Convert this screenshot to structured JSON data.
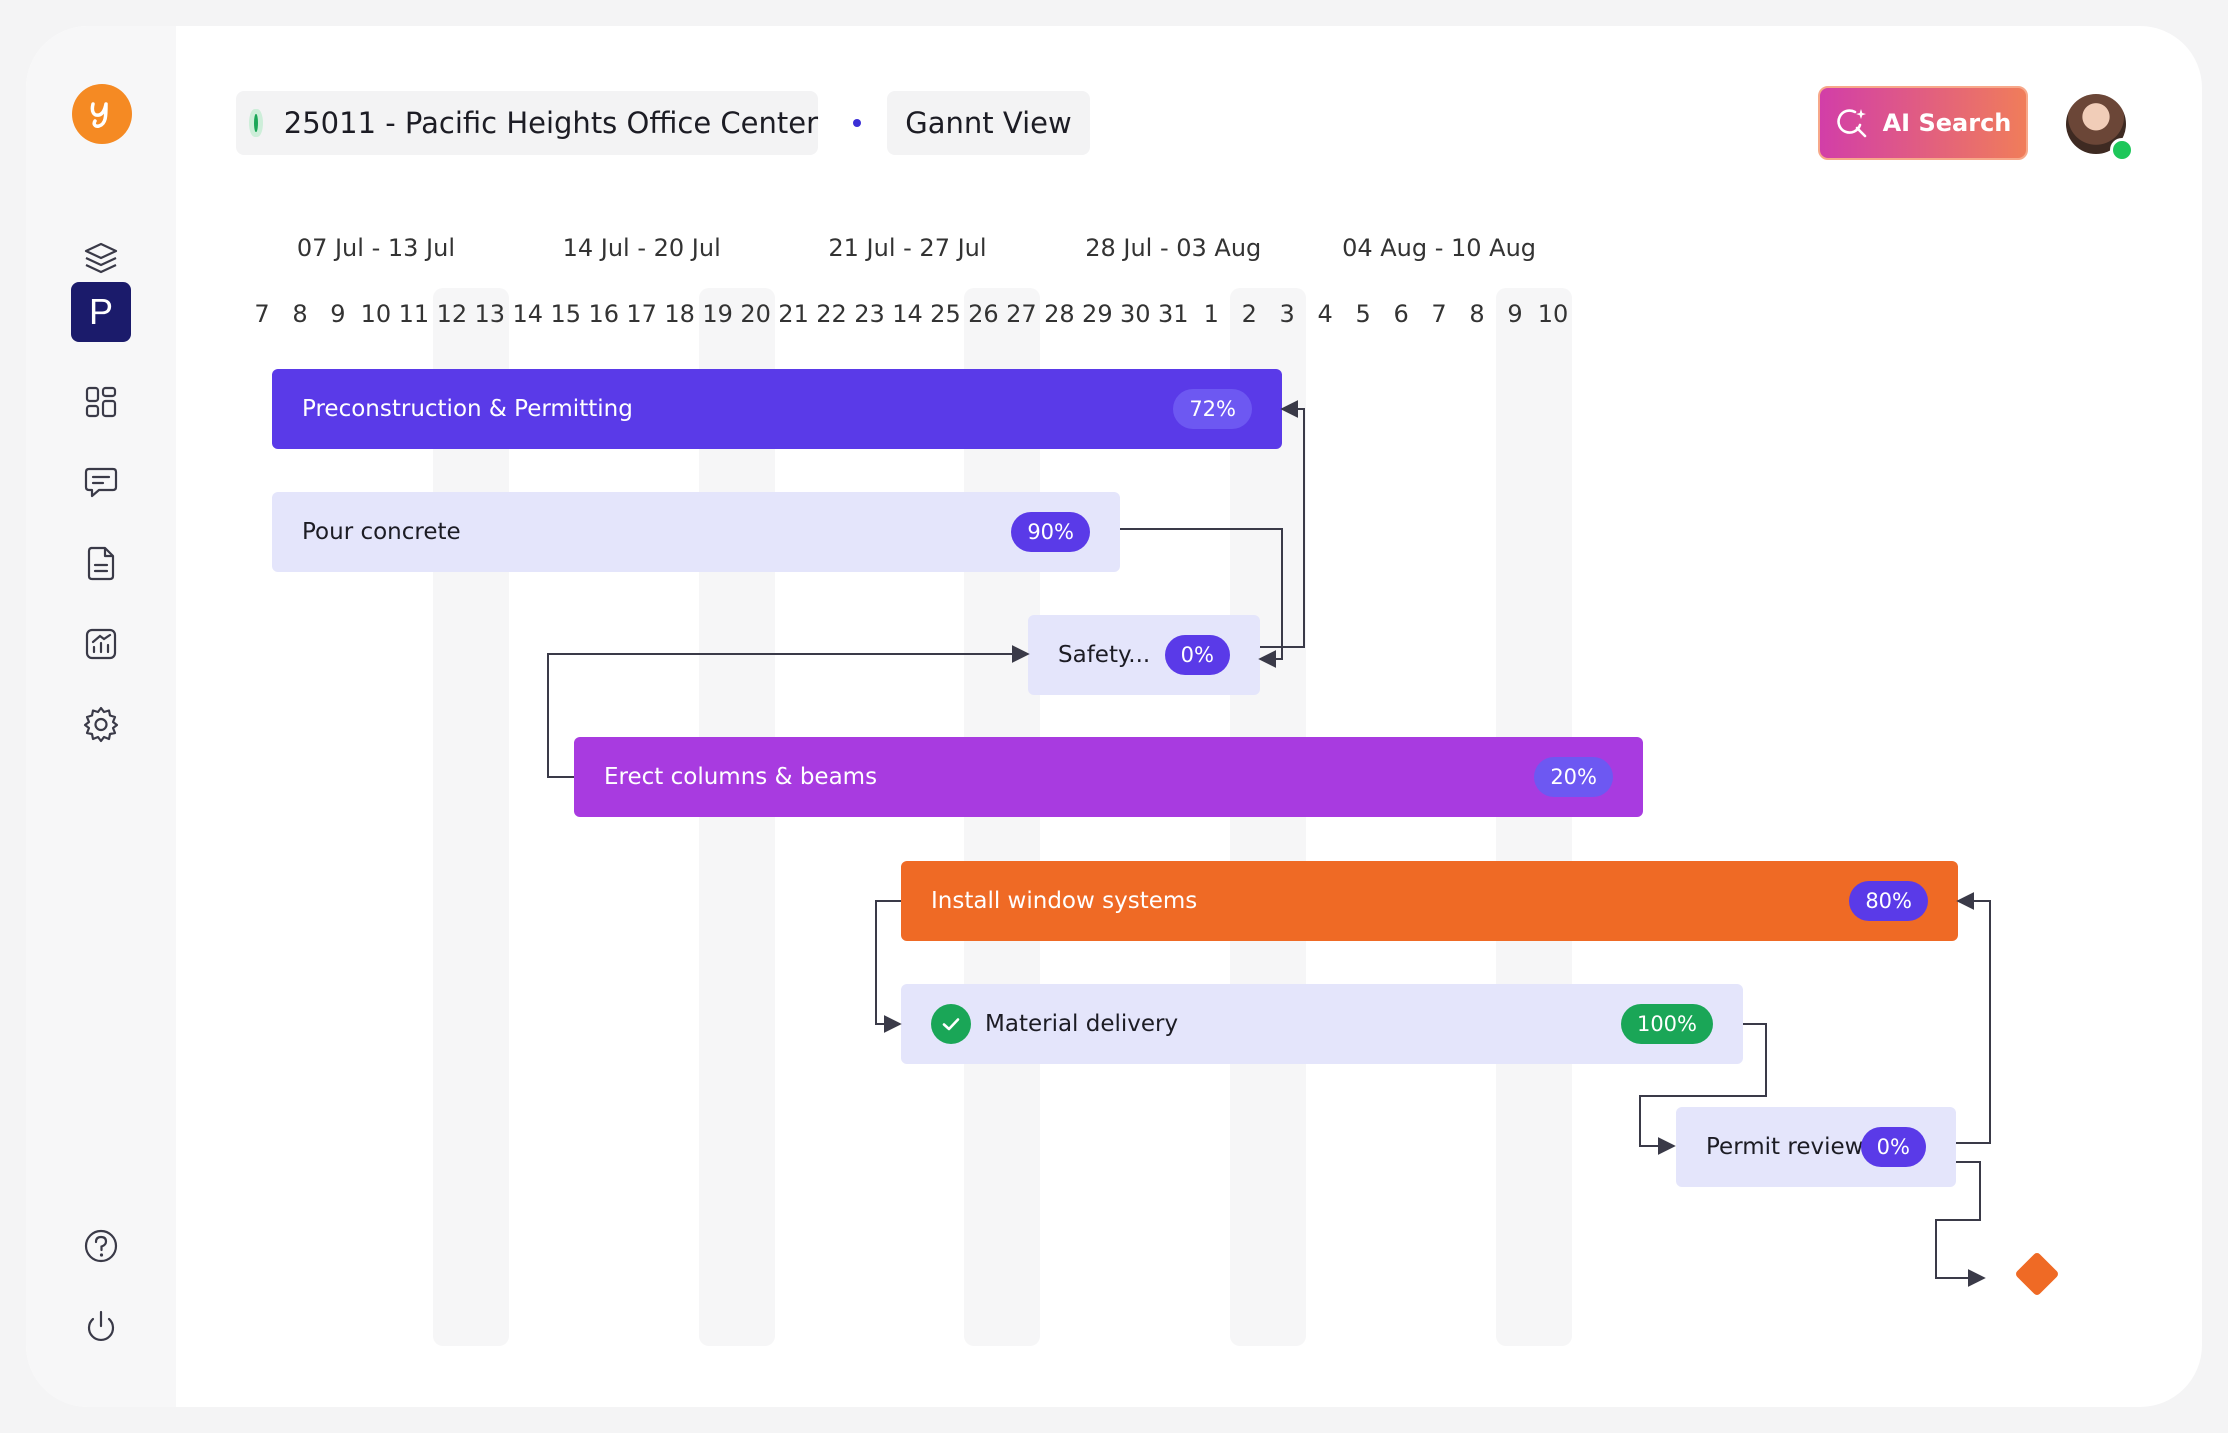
{
  "header": {
    "project_name": "25011 - Pacific Heights Office Center",
    "view_name": "Gannt View",
    "ai_search_label": "AI Search"
  },
  "sidebar": {
    "items": [
      {
        "name": "layers",
        "icon": "layers-icon"
      },
      {
        "name": "projects",
        "icon": "project-p-icon",
        "label": "P",
        "active": true
      },
      {
        "name": "dashboard",
        "icon": "grid-icon"
      },
      {
        "name": "messages",
        "icon": "chat-icon"
      },
      {
        "name": "documents",
        "icon": "document-icon"
      },
      {
        "name": "reports",
        "icon": "chart-icon"
      },
      {
        "name": "settings",
        "icon": "gear-icon"
      }
    ],
    "bottom": [
      {
        "name": "help",
        "icon": "help-icon"
      },
      {
        "name": "logout",
        "icon": "power-icon"
      }
    ]
  },
  "timeline": {
    "weeks": [
      "07 Jul - 13 Jul",
      "14 Jul - 20 Jul",
      "21 Jul - 27 Jul",
      "28 Jul - 03 Aug",
      "04 Aug - 10 Aug"
    ],
    "days": [
      "7",
      "8",
      "9",
      "10",
      "11",
      "12",
      "13",
      "14",
      "15",
      "16",
      "17",
      "18",
      "19",
      "20",
      "21",
      "22",
      "23",
      "14",
      "25",
      "26",
      "27",
      "28",
      "29",
      "30",
      "31",
      "1",
      "2",
      "3",
      "4",
      "5",
      "6",
      "7",
      "8",
      "9",
      "10"
    ]
  },
  "tasks": [
    {
      "name": "Preconstruction & Permitting",
      "percent": "72%",
      "bar": "#5a3ae8",
      "badge": "#6d58f2",
      "text": "#ffffff"
    },
    {
      "name": "Pour concrete",
      "percent": "90%",
      "bar": "#e4e5fb",
      "badge": "#5a3ae8",
      "text": "#1c1c24"
    },
    {
      "name": "Safety...",
      "percent": "0%",
      "bar": "#e4e5fb",
      "badge": "#5a3ae8",
      "text": "#1c1c24"
    },
    {
      "name": "Erect columns & beams",
      "percent": "20%",
      "bar": "#a83be0",
      "badge": "#6d58f2",
      "text": "#ffffff"
    },
    {
      "name": "Install window systems",
      "percent": "80%",
      "bar": "#ef6a25",
      "badge": "#5a3ae8",
      "text": "#ffffff"
    },
    {
      "name": "Material delivery",
      "percent": "100%",
      "bar": "#e4e5fb",
      "badge": "#1aa657",
      "text": "#1c1c24",
      "completed": true
    },
    {
      "name": "Permit review",
      "percent": "0%",
      "bar": "#e4e5fb",
      "badge": "#5a3ae8",
      "text": "#1c1c24"
    }
  ]
}
